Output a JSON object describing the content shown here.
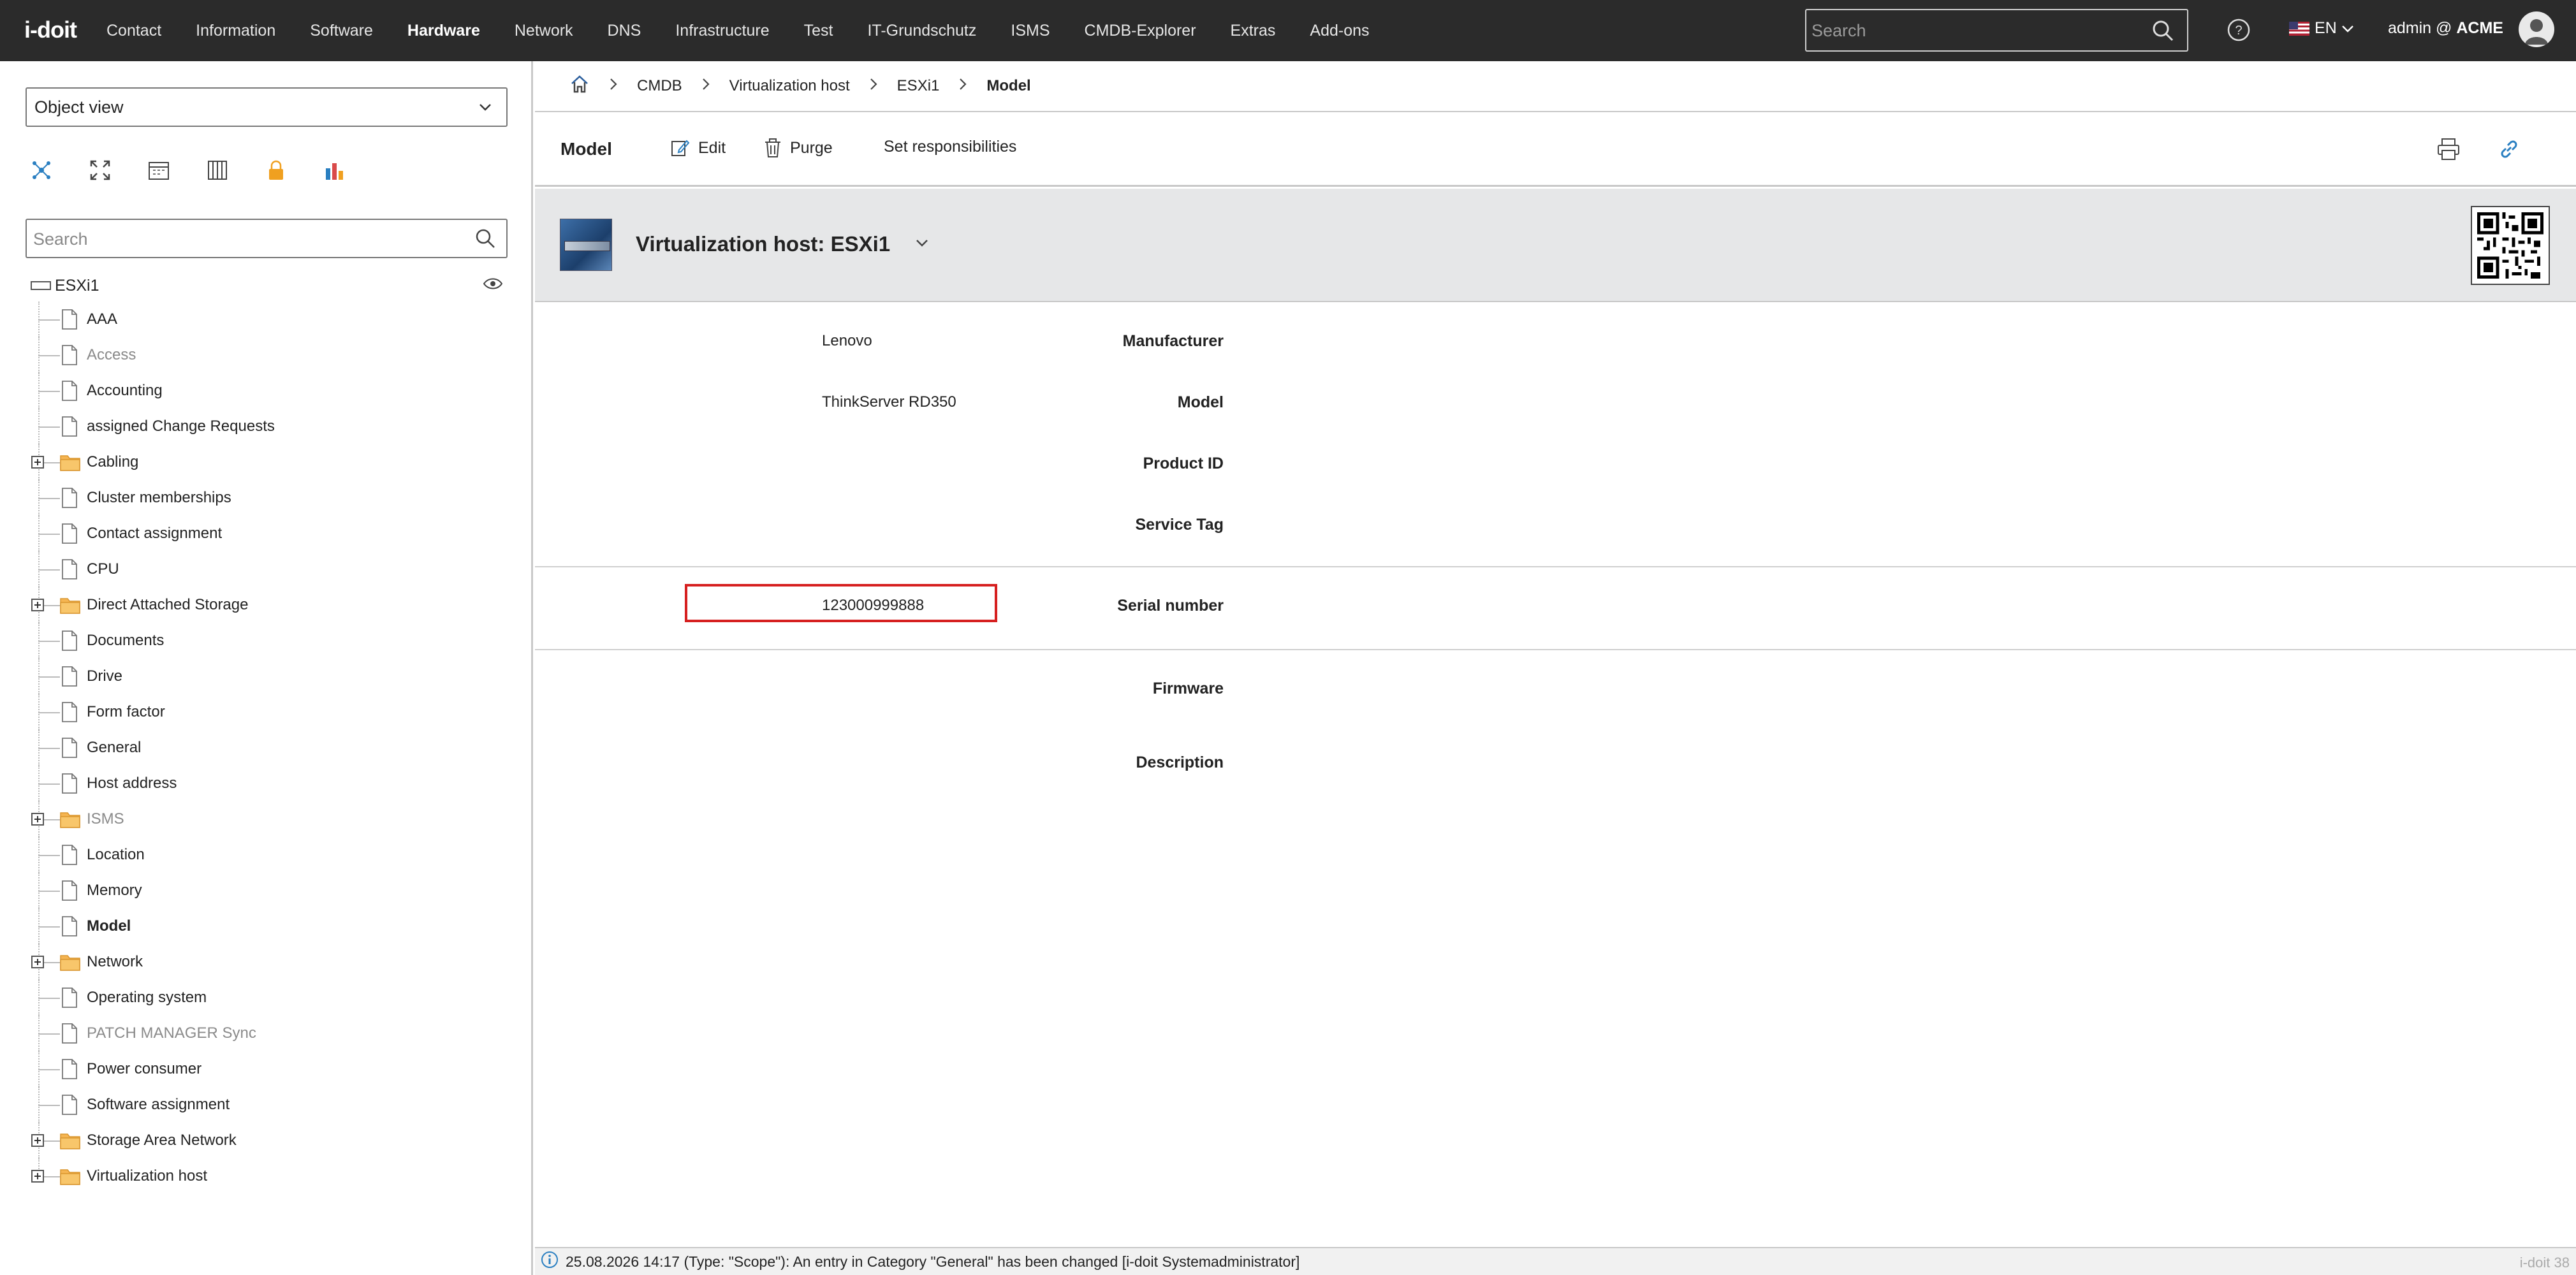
{
  "nav": {
    "logo": "i-doit",
    "items": [
      "Contact",
      "Information",
      "Software",
      "Hardware",
      "Network",
      "DNS",
      "Infrastructure",
      "Test",
      "IT-Grundschutz",
      "ISMS",
      "CMDB-Explorer",
      "Extras",
      "Add-ons"
    ],
    "active": "Hardware",
    "search_placeholder": "Search",
    "language": "EN",
    "user_prefix": "admin @",
    "tenant": "ACME"
  },
  "left": {
    "view_select": "Object view",
    "search_placeholder": "Search",
    "root": "ESXi1",
    "tools": [
      "relations-icon",
      "fullscreen-icon",
      "calendar-icon",
      "rack-icon",
      "lock-icon",
      "chart-icon"
    ],
    "tree": [
      {
        "label": "AAA",
        "type": "file"
      },
      {
        "label": "Access",
        "type": "file",
        "dim": true
      },
      {
        "label": "Accounting",
        "type": "file"
      },
      {
        "label": "assigned Change Requests",
        "type": "file"
      },
      {
        "label": "Cabling",
        "type": "folder"
      },
      {
        "label": "Cluster memberships",
        "type": "file"
      },
      {
        "label": "Contact assignment",
        "type": "file"
      },
      {
        "label": "CPU",
        "type": "file"
      },
      {
        "label": "Direct Attached Storage",
        "type": "folder"
      },
      {
        "label": "Documents",
        "type": "file"
      },
      {
        "label": "Drive",
        "type": "file"
      },
      {
        "label": "Form factor",
        "type": "file"
      },
      {
        "label": "General",
        "type": "file"
      },
      {
        "label": "Host address",
        "type": "file"
      },
      {
        "label": "ISMS",
        "type": "folder",
        "dim": true
      },
      {
        "label": "Location",
        "type": "file"
      },
      {
        "label": "Memory",
        "type": "file"
      },
      {
        "label": "Model",
        "type": "file",
        "bold": true
      },
      {
        "label": "Network",
        "type": "folder"
      },
      {
        "label": "Operating system",
        "type": "file"
      },
      {
        "label": "PATCH MANAGER Sync",
        "type": "file",
        "dim": true
      },
      {
        "label": "Power consumer",
        "type": "file"
      },
      {
        "label": "Software assignment",
        "type": "file"
      },
      {
        "label": "Storage Area Network",
        "type": "folder"
      },
      {
        "label": "Virtualization host",
        "type": "folder"
      }
    ]
  },
  "breadcrumb": [
    "CMDB",
    "Virtualization host",
    "ESXi1",
    "Model"
  ],
  "actions": {
    "page_title": "Model",
    "edit": "Edit",
    "purge": "Purge",
    "responsibilities": "Set responsibilities"
  },
  "object": {
    "title": "Virtualization host: ESXi1"
  },
  "fields": {
    "manufacturer": {
      "label": "Manufacturer",
      "value": "Lenovo"
    },
    "model": {
      "label": "Model",
      "value": "ThinkServer RD350"
    },
    "product_id": {
      "label": "Product ID",
      "value": ""
    },
    "service_tag": {
      "label": "Service Tag",
      "value": ""
    },
    "serial": {
      "label": "Serial number",
      "value": "123000999888"
    },
    "firmware": {
      "label": "Firmware",
      "value": ""
    },
    "description": {
      "label": "Description",
      "value": ""
    }
  },
  "status": {
    "message": "25.08.2026 14:17 (Type: \"Scope\"): An entry in Category \"General\" has been changed [i-doit Systemadministrator]",
    "version": "i-doit 38"
  },
  "colors": {
    "topbar": "#2b2b2b",
    "highlight": "#d62020",
    "header_bg": "#e6e7e8",
    "folder": "#f5b552",
    "accent": "#2a7fc1"
  }
}
